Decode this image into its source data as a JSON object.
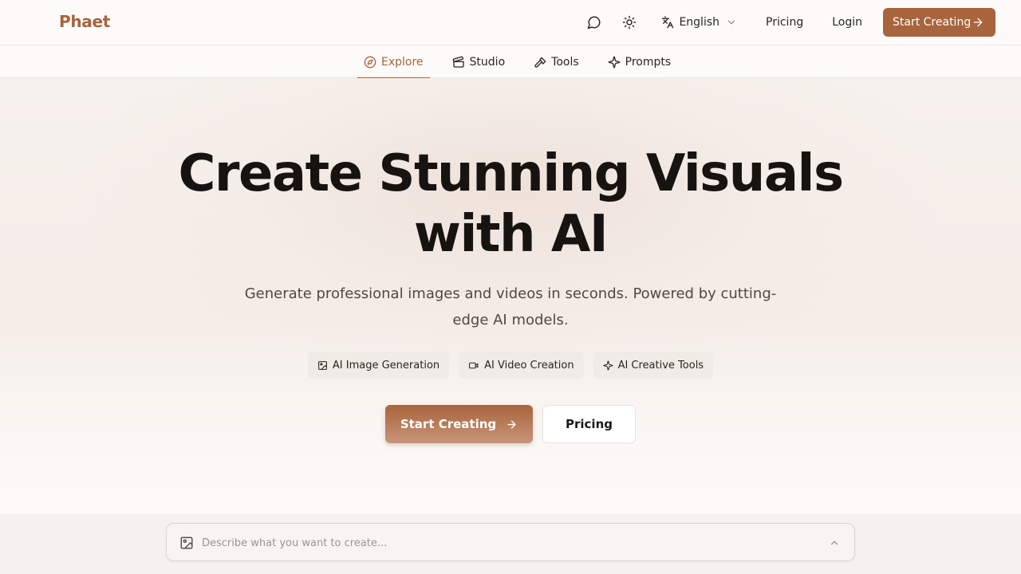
{
  "header": {
    "logo": "Phaet",
    "language": "English",
    "pricing_label": "Pricing",
    "login_label": "Login",
    "cta_label": "Start Creating"
  },
  "subnav": {
    "tabs": [
      {
        "label": "Explore",
        "icon": "compass-icon",
        "active": true
      },
      {
        "label": "Studio",
        "icon": "clapperboard-icon",
        "active": false
      },
      {
        "label": "Tools",
        "icon": "hammer-icon",
        "active": false
      },
      {
        "label": "Prompts",
        "icon": "sparkles-icon",
        "active": false
      }
    ]
  },
  "hero": {
    "title_line1": "Create Stunning Visuals",
    "title_line2": "with AI",
    "subtitle": "Generate professional images and videos in seconds. Powered by cutting-edge AI models.",
    "chips": [
      {
        "label": "AI Image Generation",
        "icon": "image-icon"
      },
      {
        "label": "AI Video Creation",
        "icon": "video-icon"
      },
      {
        "label": "AI Creative Tools",
        "icon": "sparkles-icon"
      }
    ],
    "primary_cta": "Start Creating",
    "secondary_cta": "Pricing"
  },
  "prompt_bar": {
    "placeholder": "Describe what you want to create...",
    "value": ""
  },
  "colors": {
    "accent": "#a8643c",
    "background": "#fcfbfa",
    "text": "#1c1917"
  }
}
